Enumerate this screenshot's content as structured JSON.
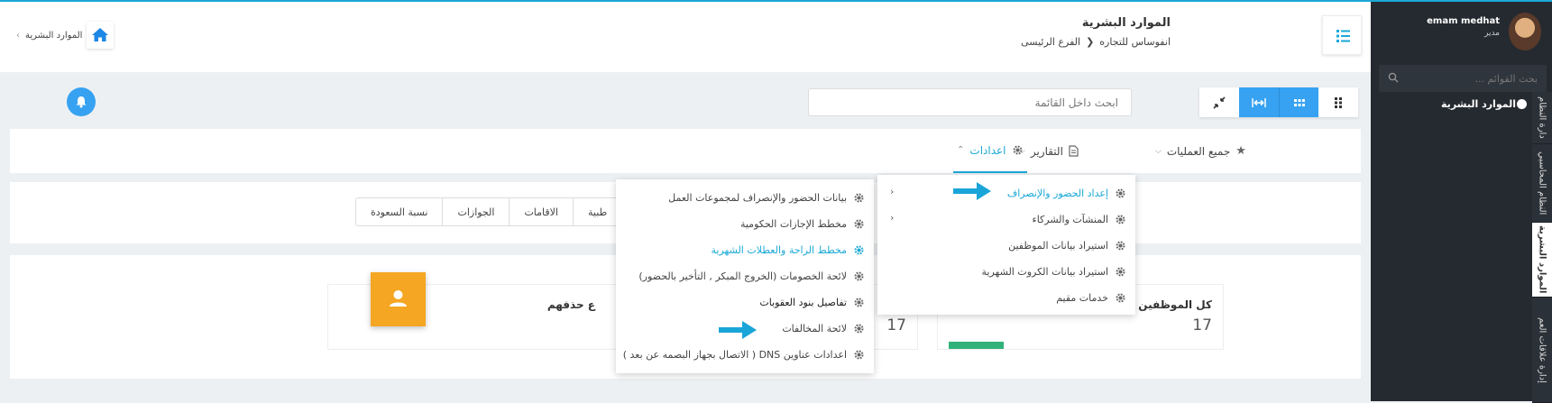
{
  "user": {
    "name": "emam medhat",
    "role": "مدير"
  },
  "sidebar": {
    "search_placeholder": "بحث القوائم ...",
    "menu_item": "الموارد البشرية",
    "vertical_tabs": [
      "دارة النظام",
      "النظام المحاسبي",
      "الموارد البشرية",
      "إدارة علاقات العم"
    ]
  },
  "header": {
    "title": "الموارد البشرية",
    "breadcrumb": [
      "انفوساس للتجاره",
      "الفرع الرئيسى"
    ],
    "left_breadcrumb": "الموارد البشرية"
  },
  "toolbar": {
    "search_placeholder": "ابحث داخل القائمة"
  },
  "tabs": [
    {
      "label": "جميع العمليات"
    },
    {
      "label": "التقارير"
    },
    {
      "label": "اعدادات"
    }
  ],
  "pills": [
    "طبية",
    "الاقامات",
    "الجوازات",
    "نسبة السعودة"
  ],
  "cards": [
    {
      "title": "كل الموظفين",
      "value": "17"
    },
    {
      "title": "",
      "value": "17"
    },
    {
      "title": "ع حذفهم",
      "value": ""
    }
  ],
  "settings_menu": {
    "items": [
      {
        "label": "إعداد الحضور والإنصراف",
        "highlight": true,
        "has_sub": true
      },
      {
        "label": "المنشآت والشركاء",
        "highlight": false,
        "has_sub": true
      },
      {
        "label": "استيراد بيانات الموظفين",
        "highlight": false,
        "has_sub": false
      },
      {
        "label": "استيراد بيانات الكروت الشهرية",
        "highlight": false,
        "has_sub": false
      },
      {
        "label": "خدمات مقيم",
        "highlight": false,
        "has_sub": false
      }
    ]
  },
  "submenu": {
    "items": [
      {
        "label": "بيانات الحضور والإنصراف لمجموعات العمل"
      },
      {
        "label": "مخطط الإجازات الحكومية"
      },
      {
        "label": "مخطط الراحة والعطلات الشهرية"
      },
      {
        "label": "لائحة الخصومات (الخروج المبكر , التأخير بالحضور)"
      },
      {
        "label": "تفاصيل بنود العقوبات"
      },
      {
        "label": "لائحة المخالفات"
      },
      {
        "label": "اعدادات عناوين DNS ( الاتصال بجهاز البصمه عن بعد )"
      }
    ]
  },
  "colors": {
    "accent": "#1ba8d6",
    "blue_button": "#37a2f1",
    "sidebar": "#252a30",
    "orange": "#f5a623",
    "green": "#30b27a"
  }
}
